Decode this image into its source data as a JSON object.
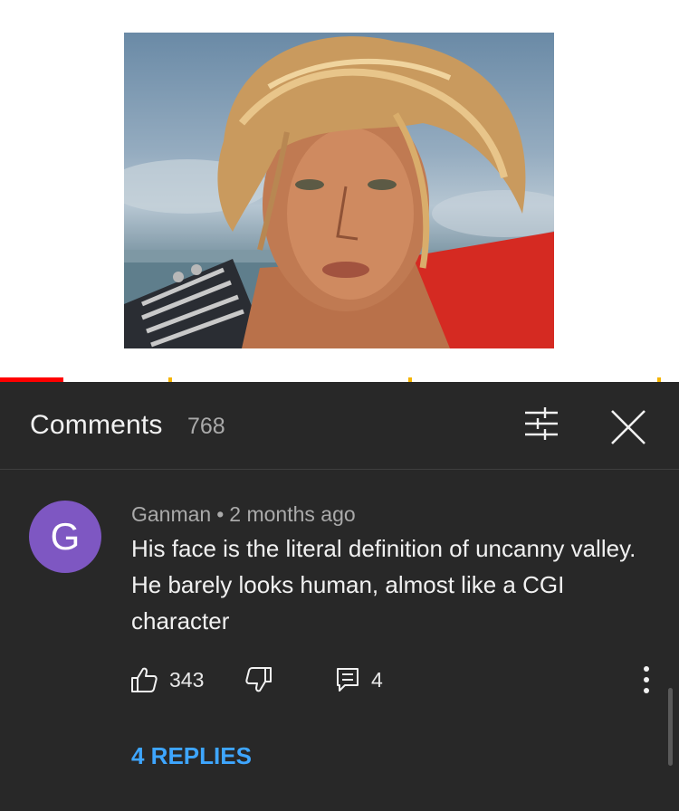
{
  "video": {
    "progress_fraction": 0.094,
    "colors": {
      "progress": "#ff0000",
      "chapter_marker": "#f4b400"
    }
  },
  "comments_panel": {
    "title": "Comments",
    "count": "768",
    "sort_icon": "sort-filter-icon",
    "close_icon": "close-icon"
  },
  "comment": {
    "avatar_letter": "G",
    "avatar_color": "#7e57c2",
    "author": "Ganman",
    "separator": "•",
    "time": "2 months ago",
    "text": "His face is the literal definition of uncanny valley. He barely looks human, almost like a CGI character",
    "likes": "343",
    "replies_count": "4",
    "view_replies": "4 REPLIES",
    "icons": {
      "like": "thumbs-up-icon",
      "dislike": "thumbs-down-icon",
      "reply": "comment-reply-icon",
      "more": "more-vertical-icon"
    }
  },
  "colors": {
    "panel_bg": "#282828",
    "link": "#3ea6ff",
    "secondary_text": "#aaaaaa"
  }
}
